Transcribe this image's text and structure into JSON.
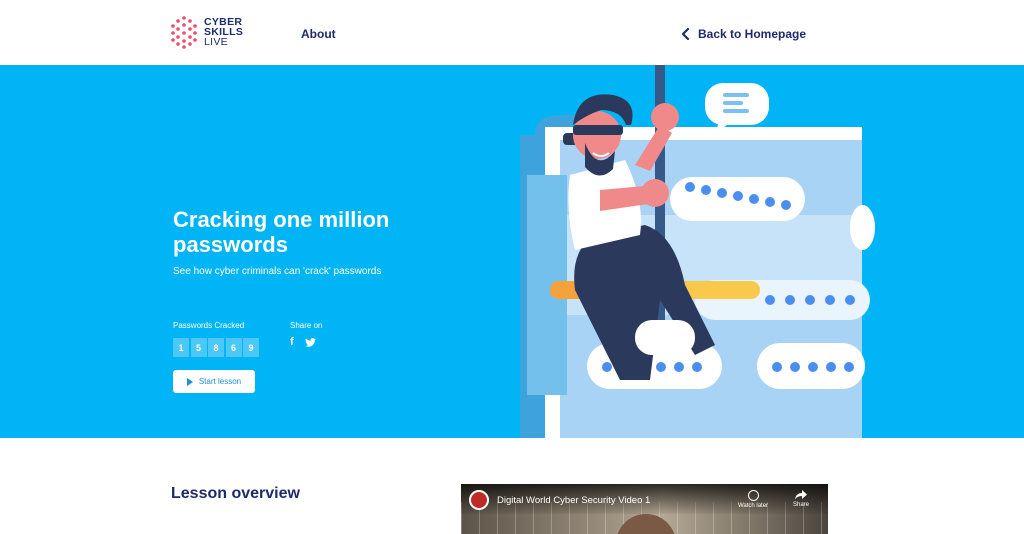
{
  "header": {
    "logo": {
      "line1": "CYBER",
      "line2": "SKILLS",
      "line3": "LIVE"
    },
    "nav_about": "About",
    "back_label": "Back to Homepage"
  },
  "hero": {
    "title": "Cracking one million passwords",
    "subtitle": "See how cyber criminals can 'crack' passwords",
    "cracked_label": "Passwords Cracked",
    "counter_digits": [
      "1",
      "5",
      "8",
      "6",
      "9"
    ],
    "share_label": "Share on",
    "share_icons": [
      "facebook-icon",
      "twitter-icon"
    ],
    "start_button": "Start lesson",
    "background_color": "#00b4f5"
  },
  "lesson": {
    "overview_heading": "Lesson overview",
    "video": {
      "title": "Digital World Cyber Security Video 1",
      "watch_later": "Watch later",
      "share": "Share"
    }
  },
  "colors": {
    "navy": "#1d2a6b",
    "accent": "#00b4f5",
    "logo_dots": "#ef4b6a"
  }
}
